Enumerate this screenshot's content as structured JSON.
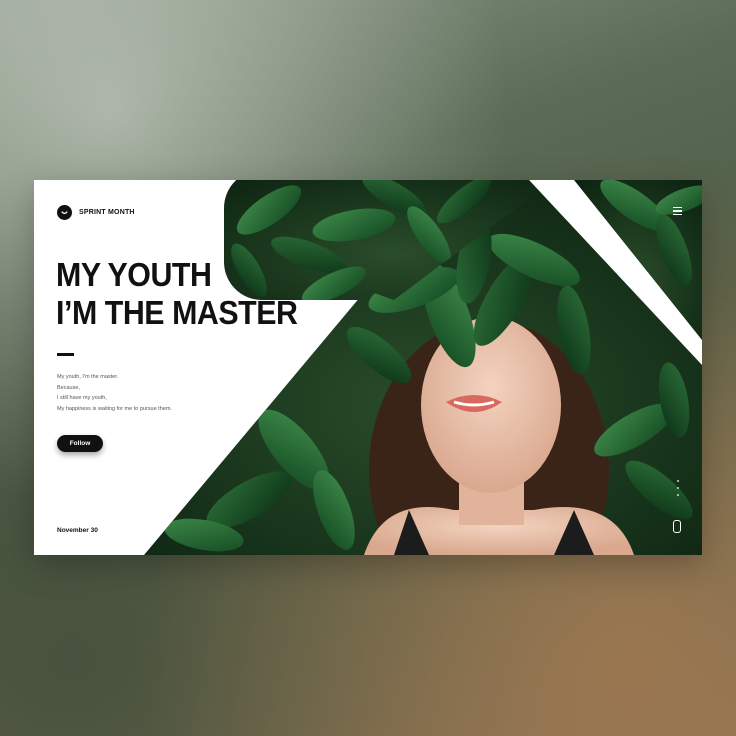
{
  "brand": {
    "name": "SPRINT MONTH",
    "logo_icon": "smiley-icon"
  },
  "nav": {
    "menu_icon": "hamburger-menu-icon"
  },
  "hero": {
    "title_line1": "MY YOUTH",
    "title_line2": "I’M THE MASTER",
    "body": [
      "My youth, I'm the master.",
      "Because,",
      "I still have my youth,",
      "My happiness is waiting for me to pursue them."
    ],
    "follow_label": "Follow",
    "date": "November 30"
  },
  "colors": {
    "accent": "#111111",
    "leaf_dark": "#123a1c",
    "leaf_mid": "#2f6b3a",
    "background_card": "#ffffff"
  }
}
